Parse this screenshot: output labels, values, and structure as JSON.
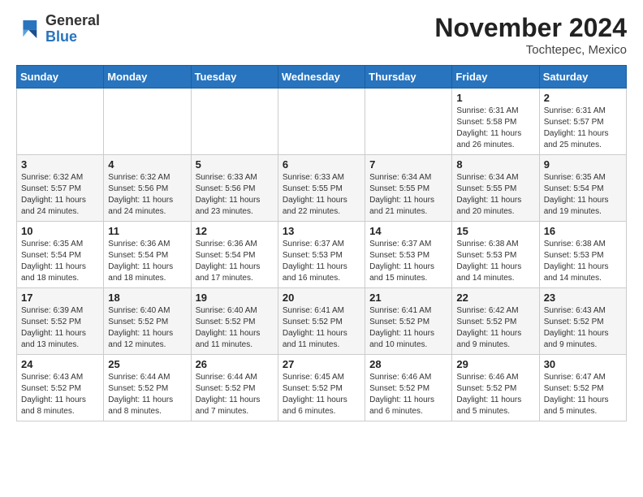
{
  "header": {
    "logo_general": "General",
    "logo_blue": "Blue",
    "month": "November 2024",
    "location": "Tochtepec, Mexico"
  },
  "weekdays": [
    "Sunday",
    "Monday",
    "Tuesday",
    "Wednesday",
    "Thursday",
    "Friday",
    "Saturday"
  ],
  "weeks": [
    [
      {
        "day": "",
        "info": ""
      },
      {
        "day": "",
        "info": ""
      },
      {
        "day": "",
        "info": ""
      },
      {
        "day": "",
        "info": ""
      },
      {
        "day": "",
        "info": ""
      },
      {
        "day": "1",
        "info": "Sunrise: 6:31 AM\nSunset: 5:58 PM\nDaylight: 11 hours\nand 26 minutes."
      },
      {
        "day": "2",
        "info": "Sunrise: 6:31 AM\nSunset: 5:57 PM\nDaylight: 11 hours\nand 25 minutes."
      }
    ],
    [
      {
        "day": "3",
        "info": "Sunrise: 6:32 AM\nSunset: 5:57 PM\nDaylight: 11 hours\nand 24 minutes."
      },
      {
        "day": "4",
        "info": "Sunrise: 6:32 AM\nSunset: 5:56 PM\nDaylight: 11 hours\nand 24 minutes."
      },
      {
        "day": "5",
        "info": "Sunrise: 6:33 AM\nSunset: 5:56 PM\nDaylight: 11 hours\nand 23 minutes."
      },
      {
        "day": "6",
        "info": "Sunrise: 6:33 AM\nSunset: 5:55 PM\nDaylight: 11 hours\nand 22 minutes."
      },
      {
        "day": "7",
        "info": "Sunrise: 6:34 AM\nSunset: 5:55 PM\nDaylight: 11 hours\nand 21 minutes."
      },
      {
        "day": "8",
        "info": "Sunrise: 6:34 AM\nSunset: 5:55 PM\nDaylight: 11 hours\nand 20 minutes."
      },
      {
        "day": "9",
        "info": "Sunrise: 6:35 AM\nSunset: 5:54 PM\nDaylight: 11 hours\nand 19 minutes."
      }
    ],
    [
      {
        "day": "10",
        "info": "Sunrise: 6:35 AM\nSunset: 5:54 PM\nDaylight: 11 hours\nand 18 minutes."
      },
      {
        "day": "11",
        "info": "Sunrise: 6:36 AM\nSunset: 5:54 PM\nDaylight: 11 hours\nand 18 minutes."
      },
      {
        "day": "12",
        "info": "Sunrise: 6:36 AM\nSunset: 5:54 PM\nDaylight: 11 hours\nand 17 minutes."
      },
      {
        "day": "13",
        "info": "Sunrise: 6:37 AM\nSunset: 5:53 PM\nDaylight: 11 hours\nand 16 minutes."
      },
      {
        "day": "14",
        "info": "Sunrise: 6:37 AM\nSunset: 5:53 PM\nDaylight: 11 hours\nand 15 minutes."
      },
      {
        "day": "15",
        "info": "Sunrise: 6:38 AM\nSunset: 5:53 PM\nDaylight: 11 hours\nand 14 minutes."
      },
      {
        "day": "16",
        "info": "Sunrise: 6:38 AM\nSunset: 5:53 PM\nDaylight: 11 hours\nand 14 minutes."
      }
    ],
    [
      {
        "day": "17",
        "info": "Sunrise: 6:39 AM\nSunset: 5:52 PM\nDaylight: 11 hours\nand 13 minutes."
      },
      {
        "day": "18",
        "info": "Sunrise: 6:40 AM\nSunset: 5:52 PM\nDaylight: 11 hours\nand 12 minutes."
      },
      {
        "day": "19",
        "info": "Sunrise: 6:40 AM\nSunset: 5:52 PM\nDaylight: 11 hours\nand 11 minutes."
      },
      {
        "day": "20",
        "info": "Sunrise: 6:41 AM\nSunset: 5:52 PM\nDaylight: 11 hours\nand 11 minutes."
      },
      {
        "day": "21",
        "info": "Sunrise: 6:41 AM\nSunset: 5:52 PM\nDaylight: 11 hours\nand 10 minutes."
      },
      {
        "day": "22",
        "info": "Sunrise: 6:42 AM\nSunset: 5:52 PM\nDaylight: 11 hours\nand 9 minutes."
      },
      {
        "day": "23",
        "info": "Sunrise: 6:43 AM\nSunset: 5:52 PM\nDaylight: 11 hours\nand 9 minutes."
      }
    ],
    [
      {
        "day": "24",
        "info": "Sunrise: 6:43 AM\nSunset: 5:52 PM\nDaylight: 11 hours\nand 8 minutes."
      },
      {
        "day": "25",
        "info": "Sunrise: 6:44 AM\nSunset: 5:52 PM\nDaylight: 11 hours\nand 8 minutes."
      },
      {
        "day": "26",
        "info": "Sunrise: 6:44 AM\nSunset: 5:52 PM\nDaylight: 11 hours\nand 7 minutes."
      },
      {
        "day": "27",
        "info": "Sunrise: 6:45 AM\nSunset: 5:52 PM\nDaylight: 11 hours\nand 6 minutes."
      },
      {
        "day": "28",
        "info": "Sunrise: 6:46 AM\nSunset: 5:52 PM\nDaylight: 11 hours\nand 6 minutes."
      },
      {
        "day": "29",
        "info": "Sunrise: 6:46 AM\nSunset: 5:52 PM\nDaylight: 11 hours\nand 5 minutes."
      },
      {
        "day": "30",
        "info": "Sunrise: 6:47 AM\nSunset: 5:52 PM\nDaylight: 11 hours\nand 5 minutes."
      }
    ]
  ]
}
